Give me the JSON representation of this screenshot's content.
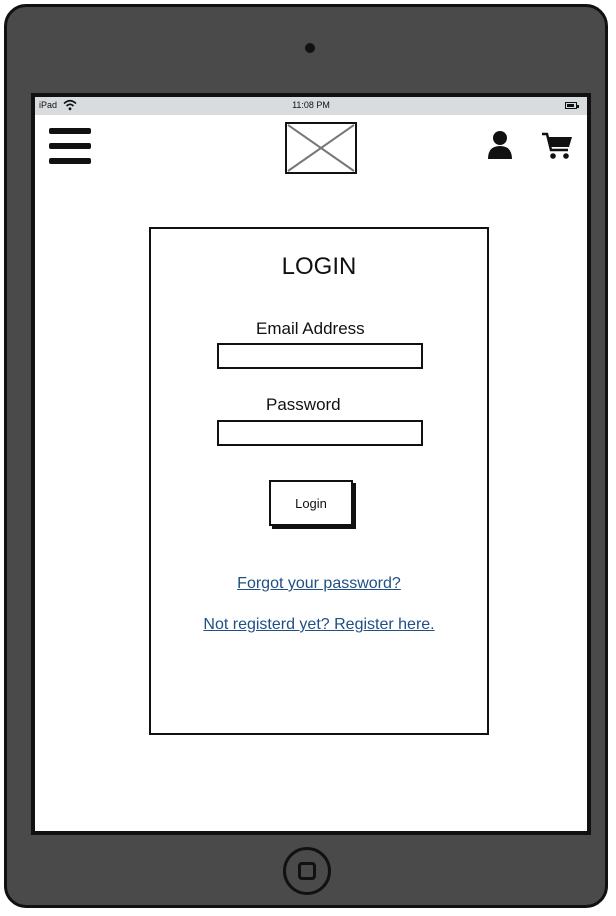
{
  "status_bar": {
    "device_name": "iPad",
    "time": "11:08 PM"
  },
  "header": {
    "menu_icon": "hamburger-menu-icon",
    "logo": "image-placeholder",
    "user_icon": "user-icon",
    "cart_icon": "shopping-cart-icon"
  },
  "login": {
    "title": "LOGIN",
    "email_label": "Email Address",
    "email_value": "",
    "password_label": "Password",
    "password_value": "",
    "button_label": "Login",
    "forgot_link": "Forgot your password?",
    "register_link": "Not registerd yet? Register here."
  },
  "colors": {
    "device_frame": "#4a4a4a",
    "status_bar": "#d9dcdf",
    "link": "#1f4f86"
  }
}
